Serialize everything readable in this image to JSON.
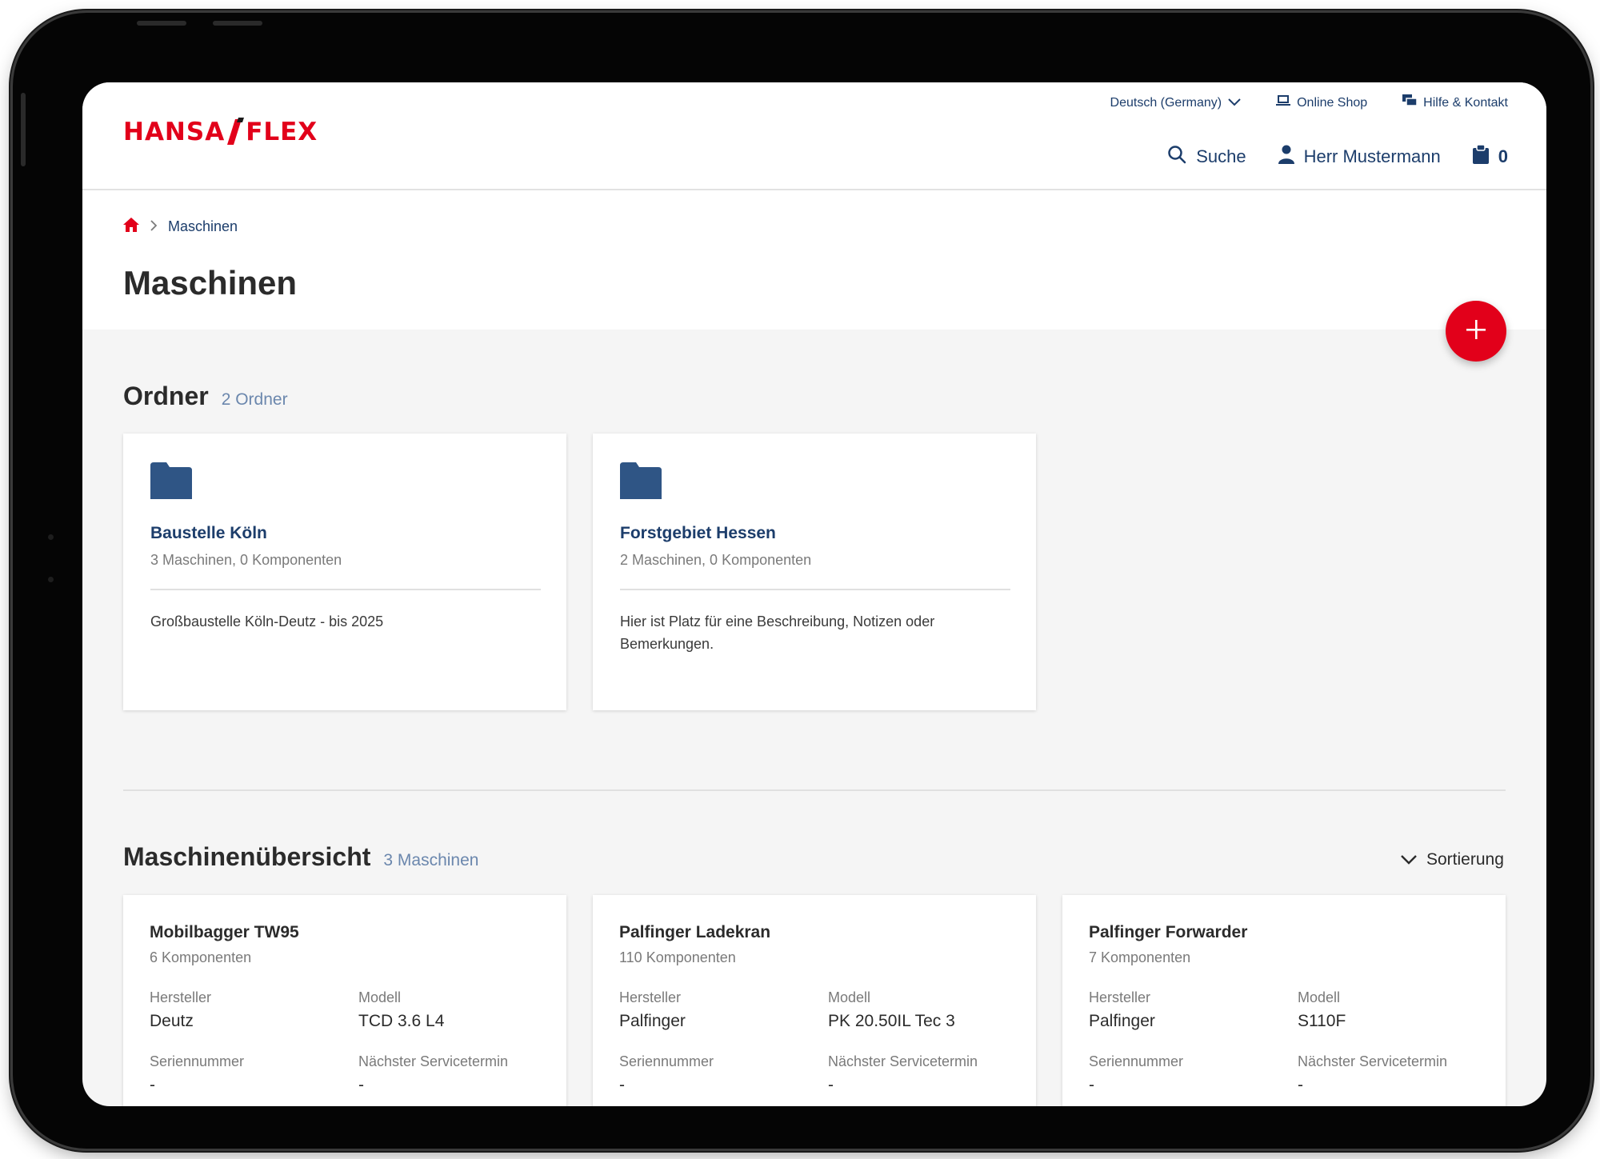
{
  "header": {
    "logo": {
      "left": "HANSA",
      "right": "FLEX"
    },
    "language": "Deutsch (Germany)",
    "online_shop": "Online Shop",
    "help": "Hilfe & Kontakt",
    "search": "Suche",
    "user": "Herr Mustermann",
    "cart_count": "0"
  },
  "breadcrumb": {
    "current": "Maschinen"
  },
  "page_title": "Maschinen",
  "folders": {
    "title": "Ordner",
    "count": "2 Ordner",
    "items": [
      {
        "name": "Baustelle Köln",
        "meta": "3 Maschinen, 0 Komponenten",
        "description": "Großbaustelle Köln-Deutz - bis 2025"
      },
      {
        "name": "Forstgebiet Hessen",
        "meta": "2 Maschinen, 0 Komponenten",
        "description": "Hier ist Platz für eine Beschreibung, Notizen oder Bemerkungen."
      }
    ]
  },
  "machines": {
    "title": "Maschinenübersicht",
    "count": "3 Maschinen",
    "sort_label": "Sortierung",
    "labels": {
      "manufacturer": "Hersteller",
      "model": "Modell",
      "serial": "Seriennummer",
      "next_service": "Nächster Servicetermin"
    },
    "items": [
      {
        "name": "Mobilbagger TW95",
        "meta": "6 Komponenten",
        "manufacturer": "Deutz",
        "model": "TCD 3.6 L4",
        "serial": "-",
        "next_service": "-"
      },
      {
        "name": "Palfinger Ladekran",
        "meta": "110 Komponenten",
        "manufacturer": "Palfinger",
        "model": "PK 20.50IL Tec 3",
        "serial": "-",
        "next_service": "-"
      },
      {
        "name": "Palfinger Forwarder",
        "meta": "7 Komponenten",
        "manufacturer": "Palfinger",
        "model": "S110F",
        "serial": "-",
        "next_service": "-"
      }
    ]
  },
  "colors": {
    "brand_red": "#e2001a",
    "navy": "#1c3d6b",
    "muted_blue": "#6b87ad",
    "folder_blue": "#2f5585"
  }
}
